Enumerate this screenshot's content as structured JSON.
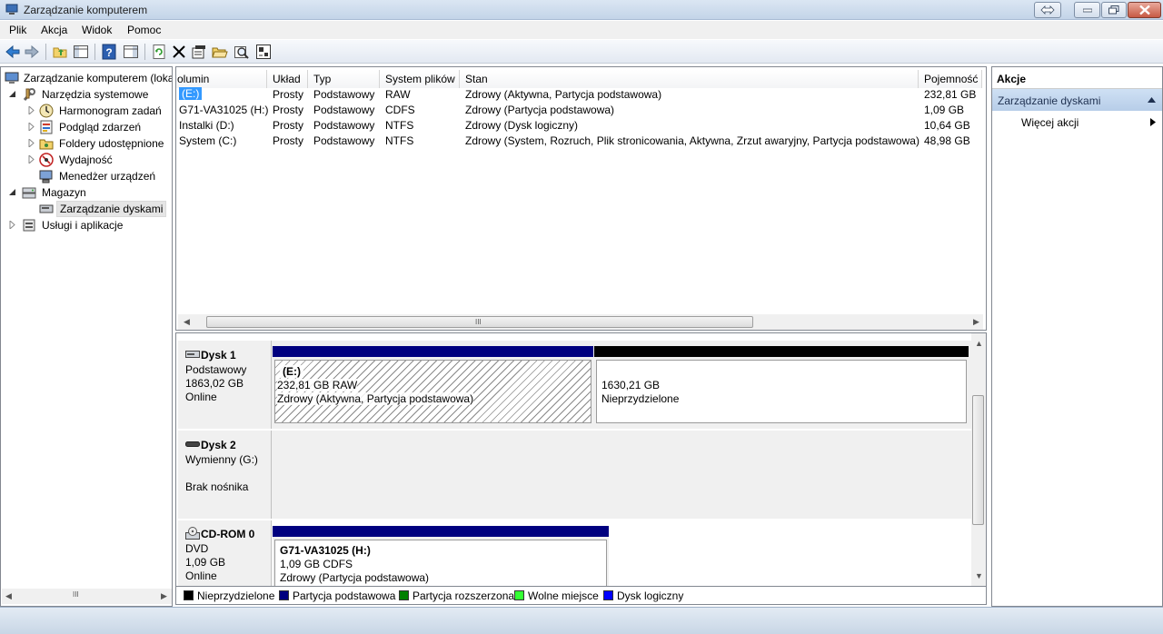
{
  "window": {
    "title": "Zarządzanie komputerem"
  },
  "menu": {
    "items": [
      "Plik",
      "Akcja",
      "Widok",
      "Pomoc"
    ]
  },
  "tree": {
    "items": [
      {
        "label": "Zarządzanie komputerem (loka",
        "icon": "computer-icon"
      },
      {
        "label": "Narzędzia systemowe",
        "icon": "tools-icon"
      },
      {
        "label": "Harmonogram zadań",
        "icon": "clock-icon"
      },
      {
        "label": "Podgląd zdarzeń",
        "icon": "event-viewer-icon"
      },
      {
        "label": "Foldery udostępnione",
        "icon": "shared-folder-icon"
      },
      {
        "label": "Wydajność",
        "icon": "performance-icon"
      },
      {
        "label": "Menedżer urządzeń",
        "icon": "device-manager-icon"
      },
      {
        "label": "Magazyn",
        "icon": "storage-icon"
      },
      {
        "label": "Zarządzanie dyskami",
        "icon": "disk-management-icon"
      },
      {
        "label": "Usługi i aplikacje",
        "icon": "services-icon"
      }
    ],
    "scroll_glyph": "III"
  },
  "volumes": {
    "columns": [
      "olumin",
      "Układ",
      "Typ",
      "System plików",
      "Stan",
      "Pojemność"
    ],
    "rows": [
      [
        "(E:)",
        "Prosty",
        "Podstawowy",
        "RAW",
        "Zdrowy (Aktywna, Partycja podstawowa)",
        "232,81 GB"
      ],
      [
        "G71-VA31025 (H:)",
        "Prosty",
        "Podstawowy",
        "CDFS",
        "Zdrowy (Partycja podstawowa)",
        "1,09 GB"
      ],
      [
        "Instalki (D:)",
        "Prosty",
        "Podstawowy",
        "NTFS",
        "Zdrowy (Dysk logiczny)",
        "10,64 GB"
      ],
      [
        "System (C:)",
        "Prosty",
        "Podstawowy",
        "NTFS",
        "Zdrowy (System, Rozruch, Plik stronicowania, Aktywna, Zrzut awaryjny, Partycja podstawowa)",
        "48,98 GB"
      ]
    ],
    "scroll_glyph": "III"
  },
  "disks": [
    {
      "name": "Dysk 1",
      "type": "Podstawowy",
      "size": "1863,02 GB",
      "status": "Online",
      "partitions": [
        {
          "title": "(E:)",
          "line1": "232,81 GB RAW",
          "line2": "Zdrowy (Aktywna, Partycja podstawowa)",
          "color": "#00007f"
        },
        {
          "title": "",
          "line1": "1630,21 GB",
          "line2": "Nieprzydzielone",
          "color": "#000000"
        }
      ]
    },
    {
      "name": "Dysk 2",
      "type": "Wymienny (G:)",
      "size": "",
      "status": "Brak nośnika"
    },
    {
      "name": "CD-ROM 0",
      "type": "DVD",
      "size": "1,09 GB",
      "status": "Online",
      "partitions": [
        {
          "title": "G71-VA31025  (H:)",
          "line1": "1,09 GB CDFS",
          "line2": "Zdrowy (Partycja podstawowa)",
          "color": "#00007f"
        }
      ]
    }
  ],
  "legend": [
    {
      "label": "Nieprzydzielone",
      "color": "#000000"
    },
    {
      "label": "Partycja podstawowa",
      "color": "#00007f"
    },
    {
      "label": "Partycja rozszerzona",
      "color": "#008000"
    },
    {
      "label": "Wolne miejsce",
      "color": "#33ff33"
    },
    {
      "label": "Dysk logiczny",
      "color": "#0000ff"
    }
  ],
  "actions": {
    "title": "Akcje",
    "section": "Zarządzanie dyskami",
    "more": "Więcej akcji"
  }
}
